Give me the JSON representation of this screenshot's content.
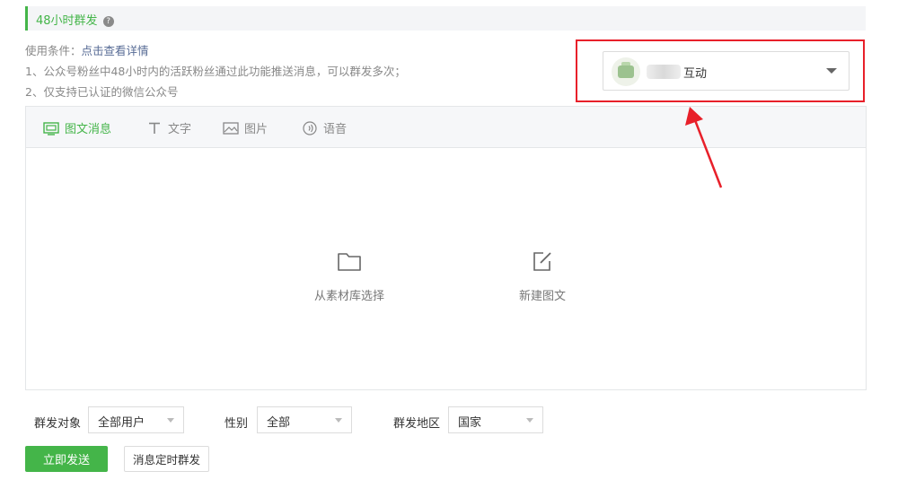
{
  "section": {
    "title": "48小时群发",
    "help_icon": "question-circle-icon"
  },
  "conditions": {
    "label": "使用条件：",
    "link": "点击查看详情",
    "rule1": "1、公众号粉丝中48小时内的活跃粉丝通过此功能推送消息，可以群发多次；",
    "rule2": "2、仅支持已认证的微信公众号"
  },
  "account_select": {
    "name": "互动",
    "highlight_color": "#e8202a"
  },
  "tabs": [
    {
      "label": "图文消息",
      "icon": "news-icon",
      "active": true
    },
    {
      "label": "文字",
      "icon": "text-icon",
      "active": false
    },
    {
      "label": "图片",
      "icon": "image-icon",
      "active": false
    },
    {
      "label": "语音",
      "icon": "voice-icon",
      "active": false
    }
  ],
  "editor_actions": {
    "library": {
      "label": "从素材库选择",
      "icon": "folder-icon"
    },
    "new": {
      "label": "新建图文",
      "icon": "edit-icon"
    }
  },
  "filters": {
    "target": {
      "label": "群发对象",
      "value": "全部用户"
    },
    "gender": {
      "label": "性别",
      "value": "全部"
    },
    "region": {
      "label": "群发地区",
      "value": "国家"
    }
  },
  "buttons": {
    "send_now": "立即发送",
    "schedule": "消息定时群发"
  },
  "colors": {
    "brand_green": "#44b549",
    "link_blue": "#576b95",
    "annotation_red": "#e8202a"
  }
}
